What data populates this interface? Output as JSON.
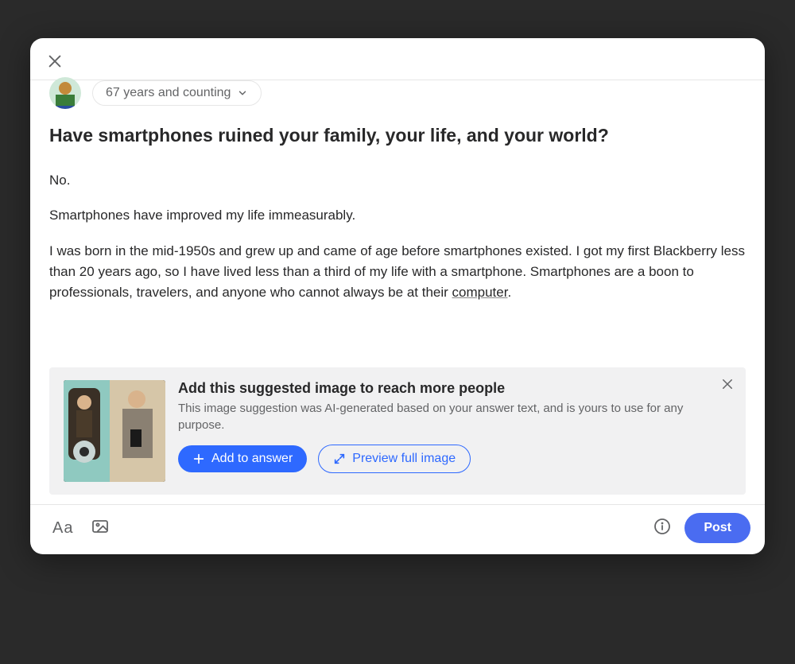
{
  "author": {
    "credential": "67 years and counting"
  },
  "question": "Have smartphones ruined your family, your life, and your world?",
  "answer": {
    "p1": "No.",
    "p2": "Smartphones have improved my life immeasurably.",
    "p3_a": "I was born in the mid-1950s and grew up and came of age before smartphones existed. I got my first Blackberry less than 20 years ago, so I have lived less than a third of my life with a smartphone. Smartphones are a boon to professionals, travelers, and anyone who cannot always be at their ",
    "p3_link": "computer",
    "p3_b": "."
  },
  "suggestion": {
    "title": "Add this suggested image to reach more people",
    "desc": "This image suggestion was AI-generated based on your answer text, and is yours to use for any purpose.",
    "add_label": "Add to answer",
    "preview_label": "Preview full image"
  },
  "footer": {
    "post_label": "Post"
  }
}
